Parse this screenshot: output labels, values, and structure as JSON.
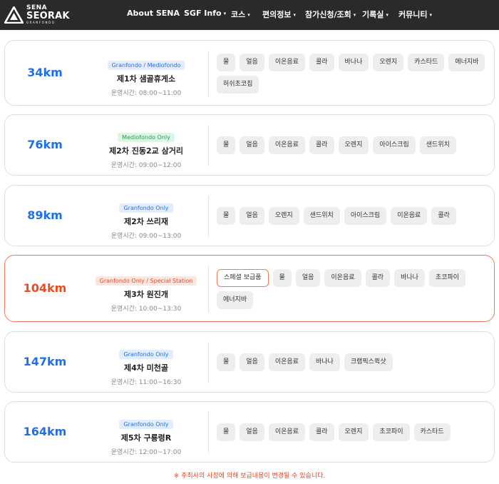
{
  "header": {
    "logo_line1": "SENA",
    "logo_line2": "SEORAK",
    "logo_line3": "GRANFONDO",
    "nav": [
      {
        "label": "About SENA",
        "dropdown": false
      },
      {
        "label": "SGF Info",
        "dropdown": true
      },
      {
        "label": "코스",
        "dropdown": true
      },
      {
        "label": "편의정보",
        "dropdown": true
      },
      {
        "label": "참가신청/조회",
        "dropdown": true
      },
      {
        "label": "기록실",
        "dropdown": true
      },
      {
        "label": "커뮤니티",
        "dropdown": true
      }
    ]
  },
  "stations": [
    {
      "distance": "34km",
      "badge": "Granfondo / Mediofondo",
      "badge_color": "blue",
      "name": "제1차 샘골휴게소",
      "hours": "운영시간: 08:00~11:00",
      "items": [
        "물",
        "얼음",
        "이온음료",
        "콜라",
        "바나나",
        "오렌지",
        "카스타드",
        "에너지바",
        "허쉬초코칩"
      ]
    },
    {
      "distance": "76km",
      "badge": "Mediofondo Only",
      "badge_color": "green",
      "name": "제2차 진동2교 삼거리",
      "hours": "운영시간: 09:00~12:00",
      "items": [
        "물",
        "얼음",
        "이온음료",
        "콜라",
        "오렌지",
        "아이스크림",
        "샌드위치"
      ]
    },
    {
      "distance": "89km",
      "badge": "Granfondo Only",
      "badge_color": "blue",
      "name": "제2차 쓰리재",
      "hours": "운영시간: 09:00~13:00",
      "items": [
        "물",
        "얼음",
        "오렌지",
        "샌드위치",
        "아이스크림",
        "이온음료",
        "콜라"
      ]
    },
    {
      "distance": "104km",
      "badge": "Granfondo Only / Special Station",
      "badge_color": "red",
      "name": "제3차 원진개",
      "hours": "운영시간: 10:00~13:30",
      "special": true,
      "items": [
        "스페셜 보급품",
        "물",
        "얼음",
        "이온음료",
        "콜라",
        "바나나",
        "초코파이",
        "에너지바"
      ]
    },
    {
      "distance": "147km",
      "badge": "Granfondo Only",
      "badge_color": "blue",
      "name": "제4차 미천골",
      "hours": "운영시간: 11:00~16:30",
      "items": [
        "물",
        "얼음",
        "이온음료",
        "바나나",
        "크램픽스퀵샷"
      ]
    },
    {
      "distance": "164km",
      "badge": "Granfondo Only",
      "badge_color": "blue",
      "name": "제5차 구룡령R",
      "hours": "운영시간: 12:00~17:00",
      "items": [
        "물",
        "얼음",
        "이온음료",
        "콜라",
        "오렌지",
        "초코파이",
        "카스타드"
      ]
    }
  ],
  "notice": "※ 주최사의 사정에 의해 보급내용이 변경될 수 있습니다."
}
